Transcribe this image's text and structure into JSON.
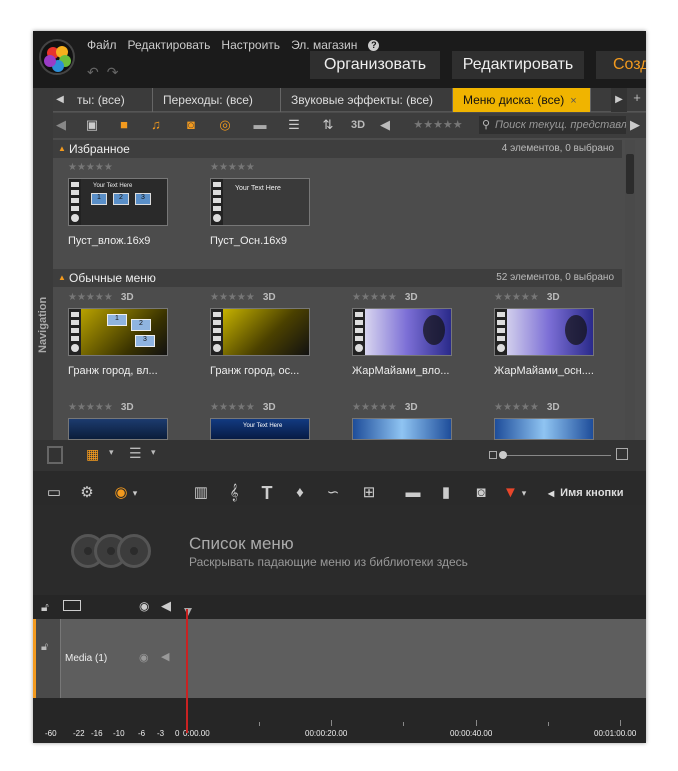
{
  "menu": {
    "file": "Файл",
    "edit": "Редактировать",
    "settings": "Настроить",
    "store": "Эл. магазин",
    "help": "?"
  },
  "modes": {
    "organize": "Организовать",
    "edit": "Редактировать",
    "create": "Созд"
  },
  "tabs": [
    {
      "label": "ты: (все)"
    },
    {
      "label": "Переходы: (все)"
    },
    {
      "label": "Звуковые эффекты: (все)"
    },
    {
      "label": "Меню диска: (все)",
      "close": "×"
    }
  ],
  "toolbar": {
    "view_3d": "3D",
    "search_placeholder": "Поиск текущ. представл"
  },
  "nav_label": "Navigation",
  "favorites": {
    "title": "Избранное",
    "count": "4 элементов, 0 выбрано",
    "items": [
      {
        "label": "Пуст_влож.16x9",
        "thumb_text": "Your Text Here"
      },
      {
        "label": "Пуст_Осн.16x9",
        "thumb_text": "Your Text Here"
      }
    ]
  },
  "regular": {
    "title": "Обычные меню",
    "count": "52 элементов, 0 выбрано",
    "items": [
      {
        "label": "Гранж город, вл...",
        "stars_3d": "3D"
      },
      {
        "label": "Гранж город, ос...",
        "stars_3d": "3D"
      },
      {
        "label": "ЖарМайами_вло...",
        "stars_3d": "3D"
      },
      {
        "label": "ЖарМайами_осн....",
        "stars_3d": "3D"
      }
    ],
    "next_row_3d": [
      "3D",
      "3D",
      "3D",
      "3D"
    ],
    "next_thumb_text": "Your Text Here"
  },
  "editor": {
    "button_name": "Имя кнопки",
    "menu_list_title": "Список меню",
    "menu_list_sub": "Раскрывать падающие меню из библиотеки здесь",
    "track_name": "Media (1)"
  },
  "ruler": {
    "levels": [
      "-60",
      "-22",
      "-16",
      "-10",
      "-6",
      "-3",
      "0"
    ],
    "times": [
      "0:00.00",
      "00:00:20.00",
      "00:00:40.00",
      "00:01:00.00"
    ]
  },
  "colors": {
    "accent": "#f39a1e",
    "active_tab": "#f0b400",
    "playhead": "#c92222"
  }
}
